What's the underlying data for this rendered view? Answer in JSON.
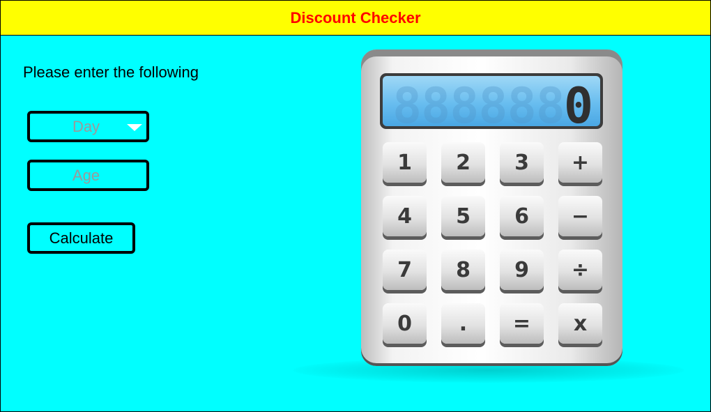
{
  "header": {
    "title": "Discount Checker"
  },
  "form": {
    "prompt": "Please enter the following",
    "day_placeholder": "Day",
    "age_placeholder": "Age",
    "calculate_label": "Calculate"
  },
  "calculator": {
    "display_value": "0",
    "ghost_segments": "888888",
    "keys": [
      "1",
      "2",
      "3",
      "+",
      "4",
      "5",
      "6",
      "−",
      "7",
      "8",
      "9",
      "÷",
      "0",
      ".",
      "=",
      "x"
    ]
  },
  "colors": {
    "background": "#00ffff",
    "header": "#ffff00",
    "title": "#ff0000"
  }
}
